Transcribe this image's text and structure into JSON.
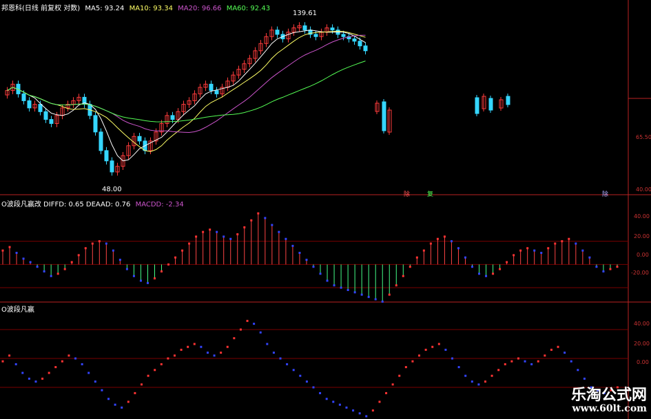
{
  "colors": {
    "up": "#ff3b3b",
    "down": "#35d6ff",
    "ma5": "#ffffff",
    "ma10": "#ffff66",
    "ma20": "#cc55cc",
    "ma60": "#55ff55",
    "grid": "#7a0000",
    "axis": "#bb2222",
    "label": "#cc3333",
    "hist_up": "#ff4444",
    "hist_down": "#44ff88",
    "wave_up": "#ff3333",
    "wave_down": "#3344ff"
  },
  "panel1": {
    "title": "邦恩科(日线 前复权 对数)",
    "ma5_label": "MA5: 93.24",
    "ma10_label": "MA10: 93.34",
    "ma20_label": "MA20: 96.66",
    "ma60_label": "MA60: 92.43",
    "high_label": "139.61",
    "low_label": "48.00",
    "y_ticks": [
      "65.50",
      "40.00"
    ],
    "y_tick_values": [
      65.5,
      40
    ],
    "markers": [
      "除",
      "复",
      "除"
    ]
  },
  "panel2": {
    "title": "O波段凡赢改 DIFFD: 0.65 DEAAD: 0.76",
    "macd_label": "MACDD: -2.34",
    "y_ticks": [
      "40.00",
      "20.00",
      "0.00",
      "-20.00"
    ],
    "y_tick_values": [
      40,
      20,
      0,
      -20
    ]
  },
  "panel3": {
    "title": "O波段凡赢",
    "y_ticks": [
      "40.00",
      "20.00",
      "0.00"
    ],
    "y_tick_values": [
      40,
      20,
      0
    ]
  },
  "watermark": {
    "line1": "乐淘公式网",
    "line2": "www.60lt.com"
  },
  "chart_data": [
    {
      "type": "candlestick",
      "title": "邦恩科(日线 前复权 对数)",
      "ylim": [
        45,
        150
      ],
      "close": [
        88,
        92,
        86,
        82,
        78,
        80,
        76,
        72,
        70,
        74,
        78,
        80,
        82,
        84,
        80,
        74,
        66,
        58,
        54,
        50,
        52,
        56,
        60,
        64,
        62,
        58,
        62,
        66,
        70,
        74,
        72,
        76,
        80,
        82,
        86,
        90,
        92,
        88,
        86,
        90,
        94,
        98,
        102,
        106,
        110,
        116,
        122,
        128,
        134,
        130,
        126,
        132,
        136,
        138,
        134,
        130,
        128,
        132,
        136,
        134,
        130,
        128,
        126,
        124,
        120,
        116
      ],
      "ma5_last": 93.24,
      "ma10_last": 93.34,
      "ma20_last": 96.66,
      "ma60_last": 92.43,
      "annotations": [
        "139.61",
        "48.00"
      ]
    },
    {
      "type": "bar",
      "title": "O波段凡赢改",
      "series": [
        {
          "name": "DIFFD",
          "values": [
            12,
            15,
            10,
            5,
            2,
            -2,
            -6,
            -10,
            -8,
            -4,
            2,
            8,
            14,
            18,
            20,
            18,
            12,
            4,
            -4,
            -10,
            -14,
            -16,
            -12,
            -6,
            0,
            6,
            12,
            18,
            24,
            28,
            30,
            28,
            24,
            22,
            26,
            32,
            38,
            44,
            40,
            34,
            28,
            22,
            16,
            10,
            4,
            -2,
            -8,
            -14,
            -18,
            -20,
            -22,
            -24,
            -26,
            -28,
            -30,
            -32,
            -26,
            -18,
            -10,
            -2,
            6,
            12,
            18,
            22,
            24,
            20,
            14,
            6,
            -2,
            -8,
            -10,
            -8,
            -4,
            2,
            8,
            12,
            14,
            12,
            10,
            14,
            18,
            20,
            22,
            18,
            12,
            6,
            -2,
            -6,
            -4,
            -2
          ]
        }
      ],
      "ylim": [
        -30,
        50
      ]
    },
    {
      "type": "line",
      "title": "O波段凡赢",
      "series": [
        {
          "name": "O波段凡赢",
          "values": [
            18,
            22,
            16,
            10,
            6,
            4,
            6,
            10,
            14,
            18,
            22,
            20,
            16,
            10,
            4,
            -2,
            -8,
            -12,
            -14,
            -10,
            -4,
            2,
            8,
            12,
            16,
            20,
            22,
            26,
            28,
            30,
            28,
            24,
            22,
            24,
            28,
            34,
            40,
            46,
            44,
            38,
            30,
            24,
            20,
            16,
            12,
            8,
            4,
            0,
            -4,
            -8,
            -10,
            -12,
            -14,
            -16,
            -18,
            -20,
            -16,
            -10,
            -4,
            2,
            8,
            14,
            18,
            22,
            26,
            28,
            30,
            26,
            20,
            14,
            8,
            4,
            2,
            4,
            8,
            12,
            16,
            18,
            20,
            18,
            16,
            18,
            22,
            26,
            28,
            24,
            18,
            12,
            6,
            0,
            -2,
            -4,
            -2,
            0
          ]
        }
      ],
      "ylim": [
        -20,
        50
      ]
    }
  ]
}
